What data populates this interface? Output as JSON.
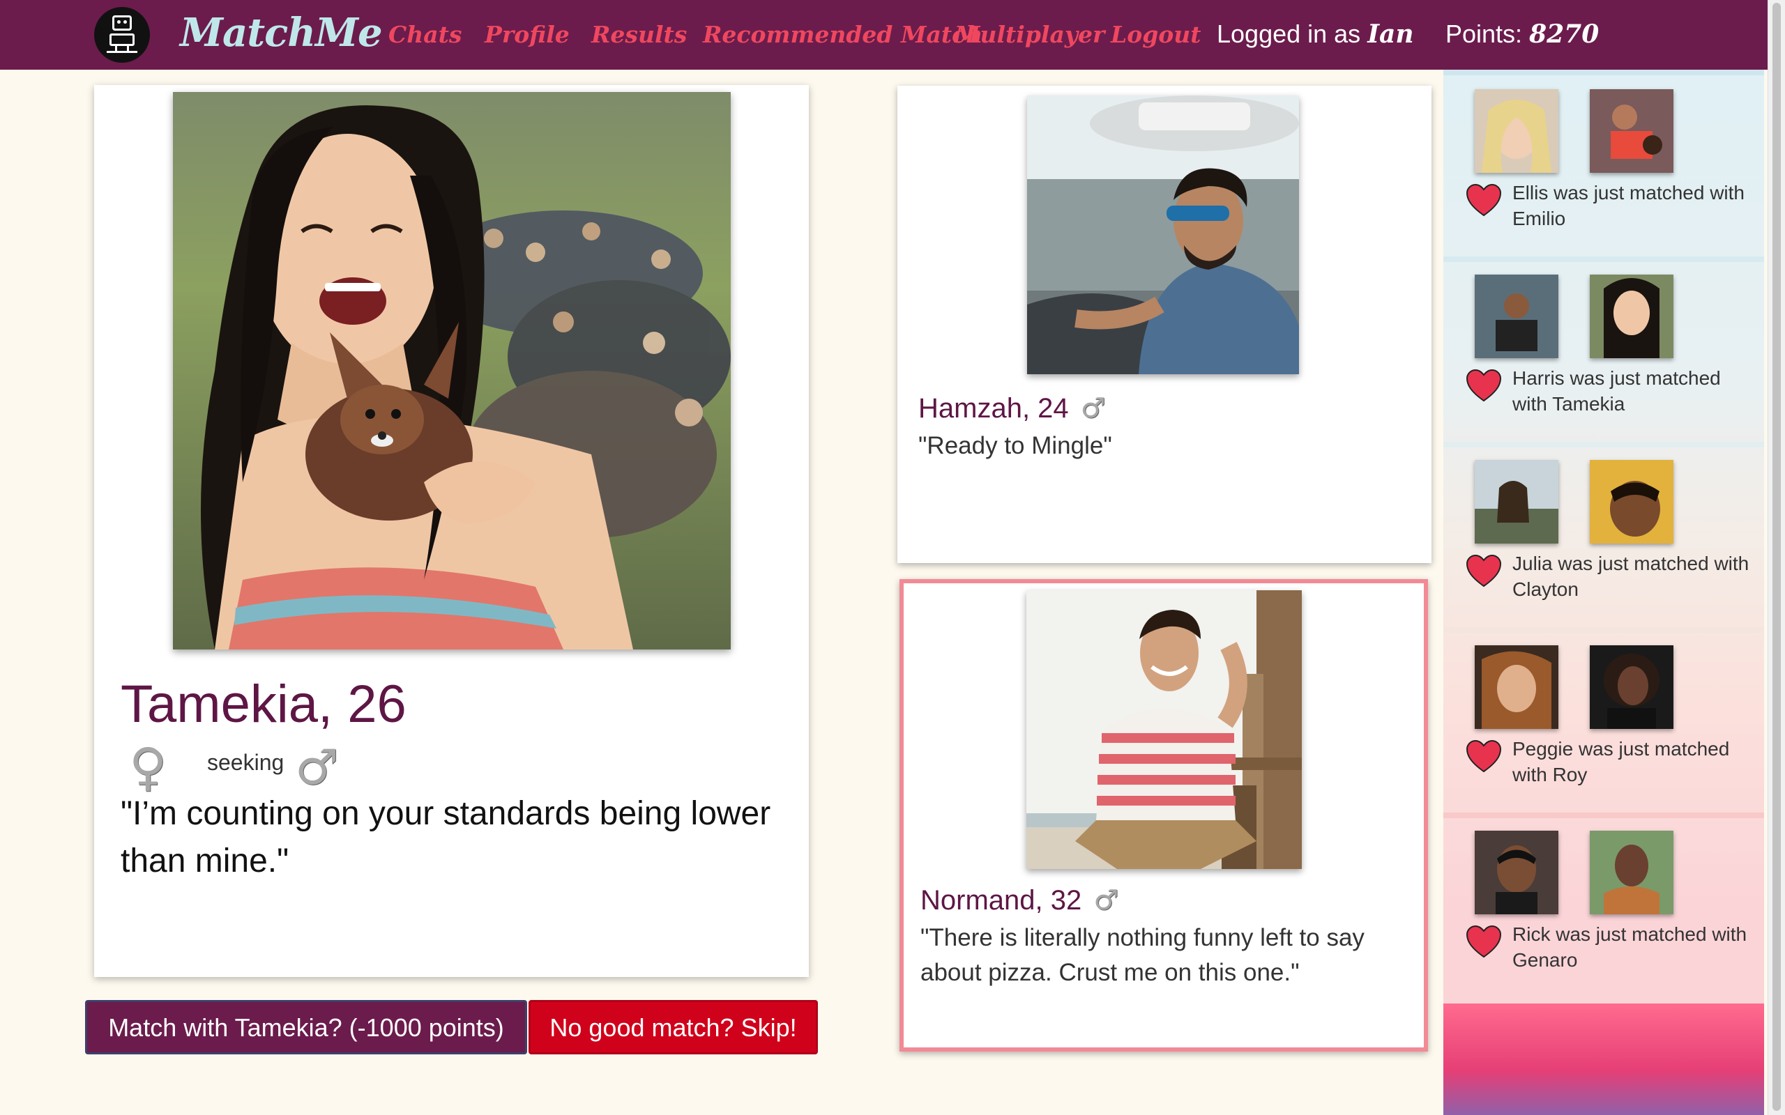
{
  "nav": {
    "brand": "MatchMe",
    "links": [
      "Chats",
      "Profile",
      "Results",
      "Recommended Match",
      "Multiplayer",
      "Logout"
    ],
    "logged_in_prefix": "Logged in as",
    "user": "Ian",
    "points_label": "Points:",
    "points": "8270"
  },
  "main_profile": {
    "name_age": "Tamekia, 26",
    "gender_symbol": "♀",
    "seeking_label": "seeking",
    "seeking_symbol": "♂",
    "quote": "\"I’m counting on your standards being lower than mine.\""
  },
  "actions": {
    "match_label": "Match with Tamekia? (-1000 points)",
    "skip_label": "No good match? Skip!"
  },
  "candidates": [
    {
      "name_age": "Hamzah, 24",
      "gender_symbol": "♂",
      "quote": "\"Ready to Mingle\"",
      "selected": false
    },
    {
      "name_age": "Normand, 32",
      "gender_symbol": "♂",
      "quote": "\"There is literally nothing funny left to say about pizza. Crust me on this one.\"",
      "selected": true
    }
  ],
  "feed": [
    {
      "text": "Ellis was just matched with Emilio"
    },
    {
      "text": "Harris was just matched with Tamekia"
    },
    {
      "text": "Julia was just matched with Clayton"
    },
    {
      "text": "Peggie was just matched with Roy"
    },
    {
      "text": "Rick was just matched with Genaro"
    }
  ],
  "colors": {
    "nav_bg": "#6b1c4c",
    "brand": "#bfe7ea",
    "nav_link": "#f0475f",
    "name": "#5e1645",
    "skip_button": "#d0021b",
    "heart": "#e8334f",
    "selected_border": "#f28a95"
  }
}
